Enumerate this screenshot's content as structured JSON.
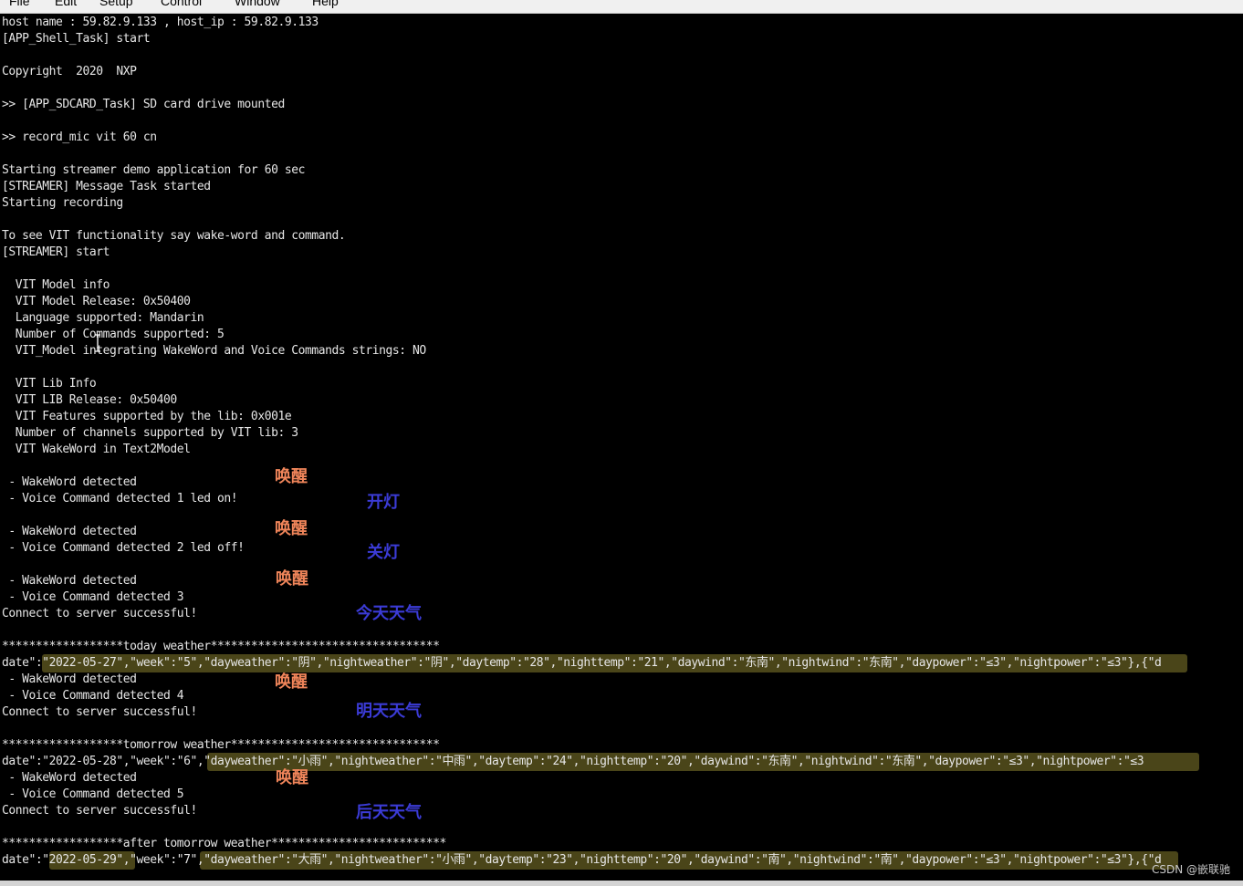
{
  "menu": [
    "File",
    "Edit",
    "Setup",
    "Control",
    "Window",
    "Help"
  ],
  "terminal": {
    "lines": [
      "host name : 59.82.9.133 , host_ip : 59.82.9.133",
      "[APP_Shell_Task] start",
      "Copyright  2020  NXP",
      ">> [APP_SDCARD_Task] SD card drive mounted",
      ">> record_mic vit 60 cn",
      "Starting streamer demo application for 60 sec",
      "[STREAMER] Message Task started",
      "Starting recording",
      "To see VIT functionality say wake-word and command.",
      "[STREAMER] start",
      "  VIT Model info",
      "  VIT Model Release: 0x50400",
      "  Language supported: Mandarin",
      "  Number of Commands supported: 5",
      "  VIT_Model integrating WakeWord and Voice Commands strings: NO",
      "  VIT Lib Info",
      "  VIT LIB Release: 0x50400",
      "  VIT Features supported by the lib: 0x001e",
      "  Number of channels supported by VIT lib: 3",
      "  VIT WakeWord in Text2Model",
      " - WakeWord detected",
      " - Voice Command detected 1 led on!",
      " - WakeWord detected",
      " - Voice Command detected 2 led off!",
      " - WakeWord detected",
      " - Voice Command detected 3",
      "Connect to server successful!",
      "******************today weather**********************************",
      "date\":\"2022-05-27\",\"week\":\"5\",\"dayweather\":\"阴\",\"nightweather\":\"阴\",\"daytemp\":\"28\",\"nighttemp\":\"21\",\"daywind\":\"东南\",\"nightwind\":\"东南\",\"daypower\":\"≤3\",\"nightpower\":\"≤3\"},{\"d",
      " - WakeWord detected",
      " - Voice Command detected 4",
      "Connect to server successful!",
      "******************tomorrow weather*******************************",
      "date\":\"2022-05-28\",\"week\":\"6\",\"dayweather\":\"小雨\",\"nightweather\":\"中雨\",\"daytemp\":\"24\",\"nighttemp\":\"20\",\"daywind\":\"东南\",\"nightwind\":\"东南\",\"daypower\":\"≤3\",\"nightpower\":\"≤3",
      " - WakeWord detected",
      " - Voice Command detected 5",
      "Connect to server successful!",
      "******************after tomorrow weather**************************",
      "date\":\"2022-05-29\",\"week\":\"7\",\"dayweather\":\"大雨\",\"nightweather\":\"小雨\",\"daytemp\":\"23\",\"nighttemp\":\"20\",\"daywind\":\"南\",\"nightwind\":\"南\",\"daypower\":\"≤3\",\"nightpower\":\"≤3\"},{\"d"
    ]
  },
  "annotations": {
    "wake_1": "唤醒",
    "cmd_1": "开灯",
    "wake_2": "唤醒",
    "cmd_2": "关灯",
    "wake_3": "唤醒",
    "cmd_3": "今天天气",
    "wake_4": "唤醒",
    "cmd_4": "明天天气",
    "wake_5": "唤醒",
    "cmd_5": "后天天气"
  },
  "watermark": "CSDN @嵌联驰",
  "colors": {
    "background": "#000000",
    "text": "#e6e6e6",
    "wake_annotation": "#f0855a",
    "command_annotation": "#3b3bd6",
    "highlight": "#787028"
  }
}
